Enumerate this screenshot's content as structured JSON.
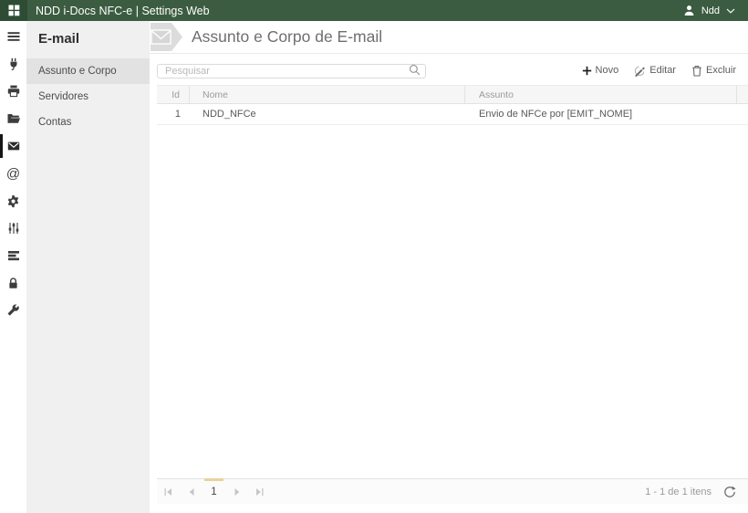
{
  "topbar": {
    "app_title": "NDD i-Docs NFC-e | Settings Web",
    "user_name": "Ndd"
  },
  "icon_rail": {
    "at_glyph": "@",
    "items": [
      {
        "icon": "menu-icon",
        "selected": false
      },
      {
        "icon": "plug-icon",
        "selected": false
      },
      {
        "icon": "printer-icon",
        "selected": false
      },
      {
        "icon": "folder-open-icon",
        "selected": false
      },
      {
        "icon": "envelope-icon",
        "selected": true
      },
      {
        "icon": "at-icon",
        "selected": false
      },
      {
        "icon": "gear-icon",
        "selected": false
      },
      {
        "icon": "sliders-icon",
        "selected": false
      },
      {
        "icon": "rows-icon",
        "selected": false
      },
      {
        "icon": "lock-icon",
        "selected": false
      },
      {
        "icon": "wrench-icon",
        "selected": false
      }
    ]
  },
  "sidebar": {
    "title": "E-mail",
    "items": [
      {
        "label": "Assunto e Corpo",
        "selected": true
      },
      {
        "label": "Servidores",
        "selected": false
      },
      {
        "label": "Contas",
        "selected": false
      }
    ]
  },
  "main": {
    "page_title": "Assunto e Corpo de E-mail",
    "search": {
      "placeholder": "Pesquisar"
    },
    "toolbar": {
      "new": "Novo",
      "edit": "Editar",
      "delete": "Excluir"
    },
    "table": {
      "columns": [
        "Id",
        "Nome",
        "Assunto"
      ],
      "rows": [
        {
          "id": "1",
          "nome": "NDD_NFCe",
          "assunto": "Envio de NFCe por [EMIT_NOME]"
        }
      ]
    },
    "pager": {
      "page": "1",
      "info": "1 - 1 de 1 itens"
    }
  },
  "colors": {
    "topbar_green": "#3b5c40",
    "topbar_tile_green": "#2e4c34",
    "sidebar_bg": "#f0f0f0",
    "sidebar_selected_bg": "#e2e2e2",
    "page_indicator_yellow": "#e6d49c"
  }
}
